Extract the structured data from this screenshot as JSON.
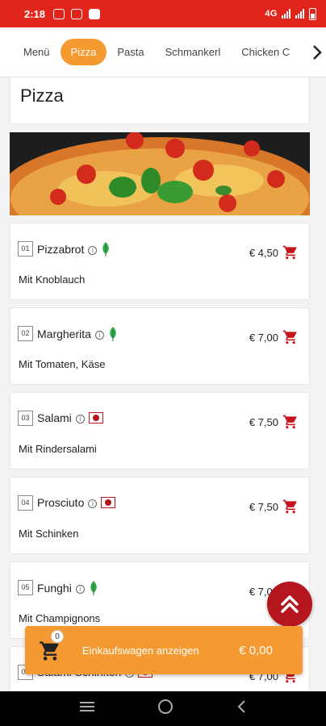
{
  "status_bar": {
    "time": "2:18",
    "network": "4G"
  },
  "tabs": [
    {
      "label": "Menü",
      "active": false
    },
    {
      "label": "Pizza",
      "active": true
    },
    {
      "label": "Pasta",
      "active": false
    },
    {
      "label": "Schmankerl",
      "active": false
    },
    {
      "label": "Chicken C",
      "active": false
    }
  ],
  "section_title": "Pizza",
  "items": [
    {
      "num": "01",
      "name": "Pizzabrot",
      "badge": "vegetarian",
      "desc": "Mit Knoblauch",
      "price": "€ 4,50"
    },
    {
      "num": "02",
      "name": "Margherita",
      "badge": "vegetarian",
      "desc": "Mit Tomaten, Käse",
      "price": "€ 7,00"
    },
    {
      "num": "03",
      "name": "Salami",
      "badge": "meat",
      "desc": "Mit Rindersalami",
      "price": "€ 7,50"
    },
    {
      "num": "04",
      "name": "Prosciuto",
      "badge": "meat",
      "desc": "Mit Schinken",
      "price": "€ 7,50"
    },
    {
      "num": "05",
      "name": "Funghi",
      "badge": "vegetarian",
      "desc": "Mit Champignons",
      "price": "€ 7,00"
    },
    {
      "num": "06",
      "name": "Salami Schinken",
      "badge": "meat",
      "desc": "",
      "price": "€ 7,00"
    }
  ],
  "cart": {
    "count": "0",
    "label": "Einkaufswagen anzeigen",
    "total": "€ 0,00"
  },
  "colors": {
    "status_red": "#e1251b",
    "accent_orange": "#f59a30",
    "cart_red": "#c4161c",
    "veg_green": "#2eaa4a"
  },
  "icons": {
    "info": "info-icon",
    "veg": "leaf-icon",
    "meat": "meat-icon",
    "cart": "cart-icon",
    "scroll_top": "double-chevron-up-icon"
  }
}
